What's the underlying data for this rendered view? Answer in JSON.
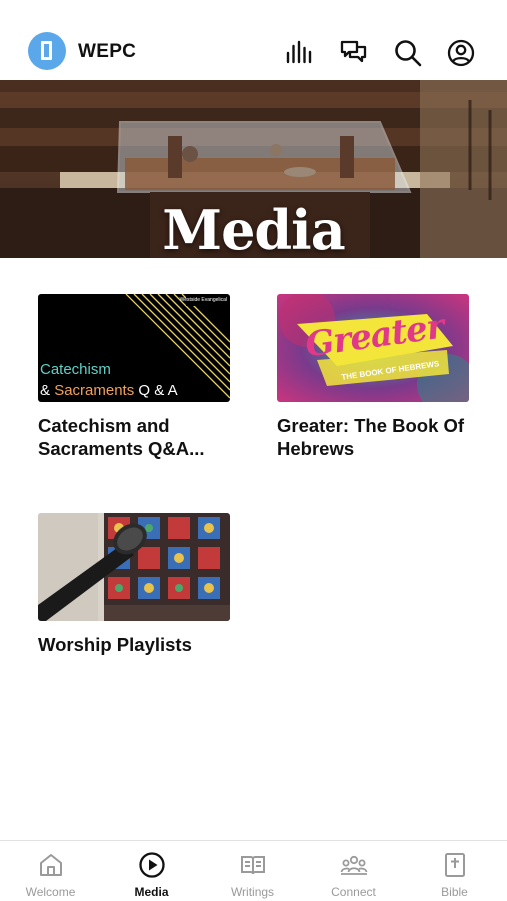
{
  "header": {
    "brand": "WEPC"
  },
  "hero": {
    "title": "Media"
  },
  "cards": [
    {
      "title": "Catechism and Sacraments Q&A...",
      "thumb_line1": "Catechism",
      "thumb_amp": "& ",
      "thumb_word2": "Sacraments",
      "thumb_qa": " Q & A",
      "thumb_corner": "Westside Evangelical"
    },
    {
      "title": "Greater: The Book Of Hebrews",
      "thumb_main": "Greater",
      "thumb_sub": "THE BOOK OF HEBREWS"
    },
    {
      "title": "Worship Playlists"
    }
  ],
  "tabs": [
    {
      "label": "Welcome",
      "icon": "home-icon"
    },
    {
      "label": "Media",
      "icon": "play-circle-icon"
    },
    {
      "label": "Writings",
      "icon": "book-open-icon"
    },
    {
      "label": "Connect",
      "icon": "people-icon"
    },
    {
      "label": "Bible",
      "icon": "bible-icon"
    }
  ],
  "colors": {
    "accent": "#5aa7ea",
    "active_tab": "#111111",
    "inactive_tab": "#9a9a9a",
    "catechism_teal": "#5fd0c6",
    "catechism_orange": "#f0a15a",
    "gold_stripes": "#e8d36a"
  }
}
